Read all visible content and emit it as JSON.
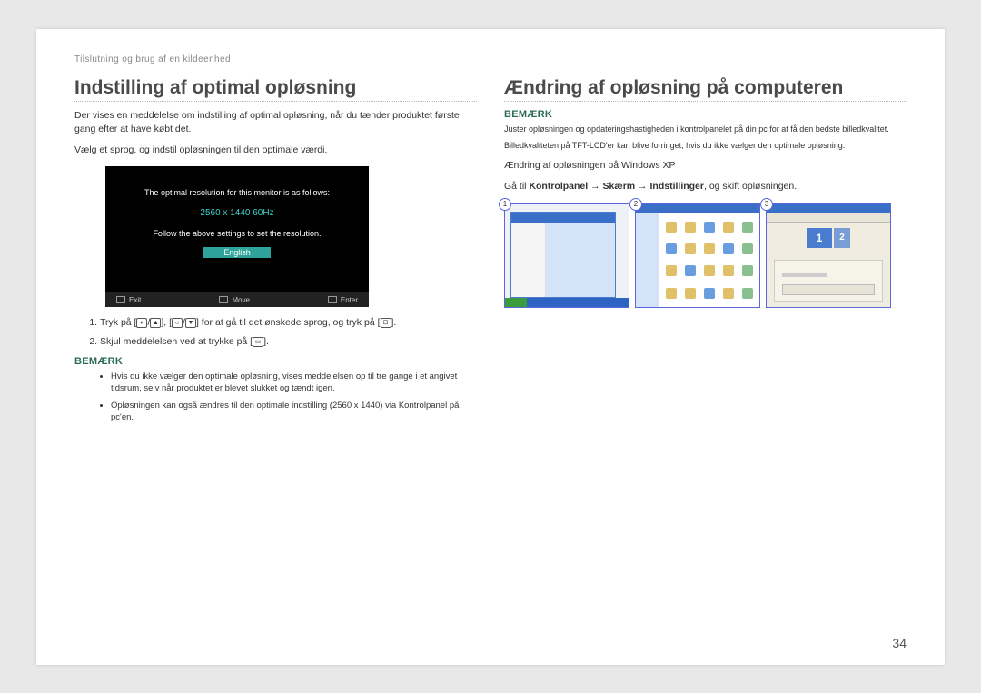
{
  "breadcrumb": "Tilslutning og brug af en kildeenhed",
  "left": {
    "heading": "Indstilling af optimal opløsning",
    "p1": "Der vises en meddelelse om indstilling af optimal opløsning, når du tænder produktet første gang efter at have købt det.",
    "p2": "Vælg et sprog, og indstil opløsningen til den optimale værdi.",
    "monitor": {
      "line1": "The optimal resolution for this monitor is as follows:",
      "resolution": "2560 x 1440  60Hz",
      "line2": "Follow the above settings to set the resolution.",
      "lang": "English",
      "exit": "Exit",
      "move": "Move",
      "enter": "Enter"
    },
    "steps": {
      "s1a": "Tryk på [",
      "s1b": "] for at gå til det ønskede sprog, og tryk på [",
      "s1c": "].",
      "s2a": "Skjul meddelelsen ved at trykke på [",
      "s2b": "]."
    },
    "note_label": "BEMÆRK",
    "notes": {
      "n1": "Hvis du ikke vælger den optimale opløsning, vises meddelelsen op til tre gange i et angivet tidsrum, selv når produktet er blevet slukket og tændt igen.",
      "n2": "Opløsningen kan også ændres til den optimale indstilling (2560 x 1440) via Kontrolpanel på pc'en."
    }
  },
  "right": {
    "heading": "Ændring af opløsning på computeren",
    "note_label": "BEMÆRK",
    "note_p1": "Juster opløsningen og opdateringshastigheden i kontrolpanelet på din pc for at få den bedste billedkvalitet.",
    "note_p2": "Billedkvaliteten på TFT-LCD'er kan blive forringet, hvis du ikke vælger den optimale opløsning.",
    "sub": "Ændring af opløsningen på Windows XP",
    "path_pre": "Gå til ",
    "path1": "Kontrolpanel",
    "arrow": " → ",
    "path2": "Skærm",
    "path3": "Indstillinger",
    "path_post": ", og skift opløsningen.",
    "shots": [
      "1",
      "2",
      "3"
    ],
    "mon1": "1",
    "mon2": "2"
  },
  "page_number": "34"
}
